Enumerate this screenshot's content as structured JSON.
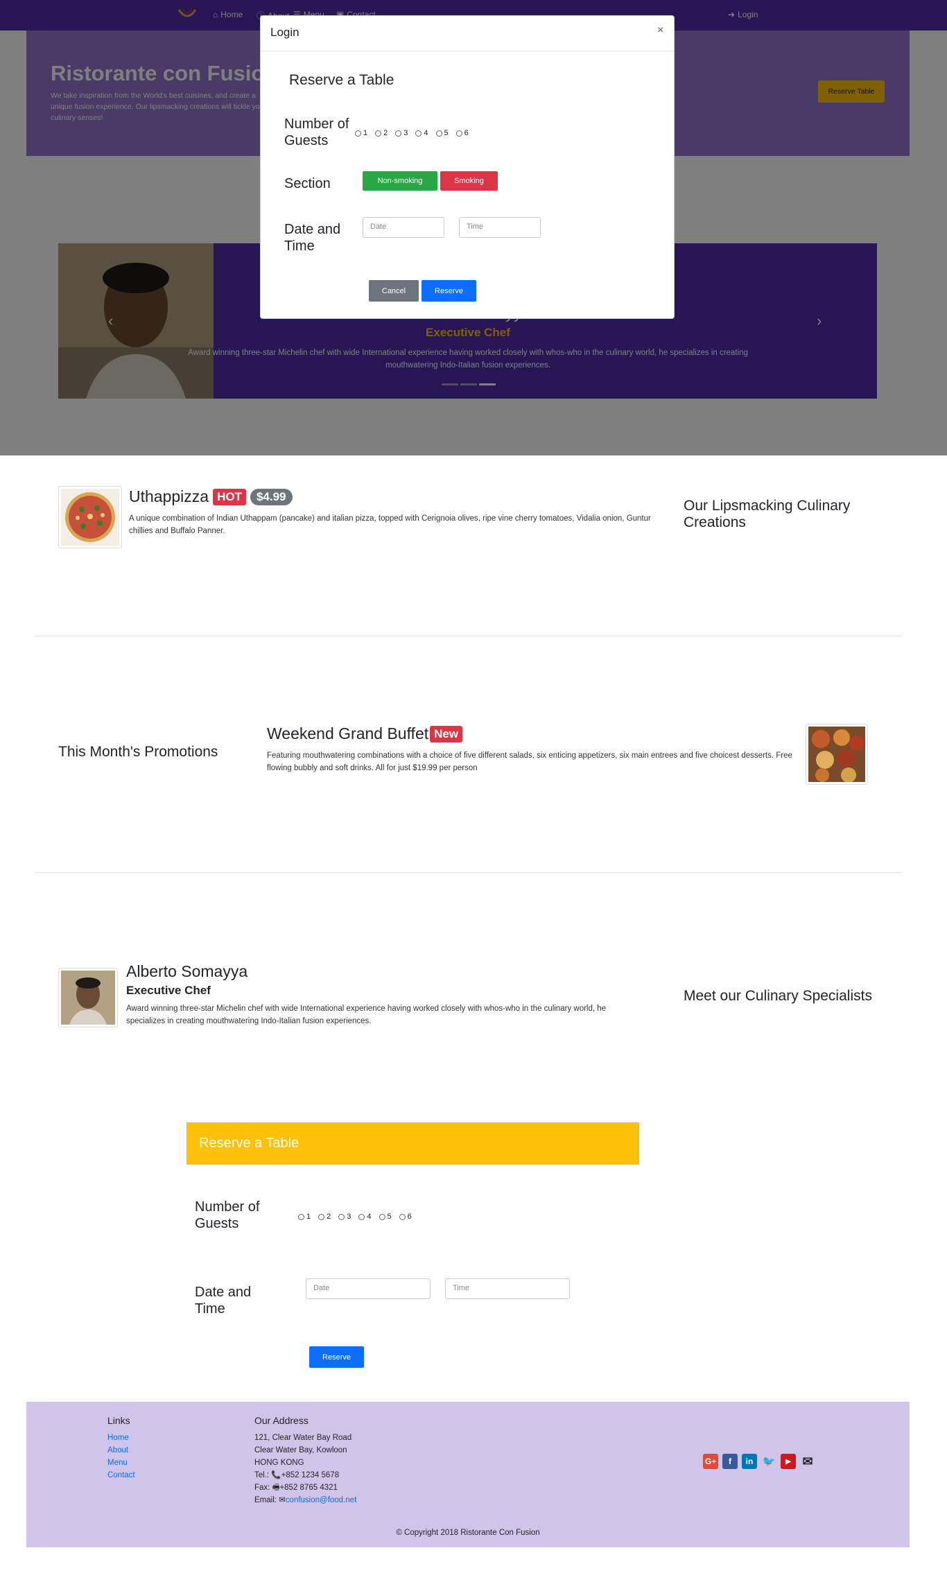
{
  "navbar": {
    "home": "Home",
    "about": "About",
    "menu": "Menu",
    "contact": "Contact",
    "login": "Login"
  },
  "jumbotron": {
    "title": "Ristorante con Fusion",
    "text": "We take inspiration from the World's best cuisines, and create a unique fusion experience. Our lipsmacking creations will tickle your culinary senses!",
    "button": "Reserve Table"
  },
  "carousel": {
    "name": "Alberto Somayya",
    "role": "Executive Chef",
    "description": "Award winning three-star Michelin chef with wide International experience having worked closely with whos-who in the culinary world, he specializes in creating mouthwatering Indo-Italian fusion experiences."
  },
  "modal": {
    "title": "Login",
    "close": "×",
    "heading": "Reserve a Table",
    "guests_label": "Number of Guests",
    "guest_options": [
      "1",
      "2",
      "3",
      "4",
      "5",
      "6"
    ],
    "section_label": "Section",
    "non_smoking": "Non-smoking",
    "smoking": "Smoking",
    "datetime_label": "Date and Time",
    "date_placeholder": "Date",
    "time_placeholder": "Time",
    "cancel": "Cancel",
    "reserve": "Reserve"
  },
  "dish": {
    "title": "Uthappizza",
    "badge": "HOT",
    "price": "$4.99",
    "description": "A unique combination of Indian Uthappam (pancake) and italian pizza, topped with Cerignoia olives, ripe vine cherry tomatoes, Vidalia onion, Guntur chillies and Buffalo Panner.",
    "section_heading": "Our Lipsmacking Culinary Creations"
  },
  "promotion": {
    "section_heading": "This Month's Promotions",
    "title": "Weekend Grand Buffet",
    "badge": "New",
    "description": "Featuring mouthwatering combinations with a choice of five different salads, six enticing appetizers, six main entrees and five choicest desserts. Free flowing bubbly and soft drinks. All for just $19.99 per person"
  },
  "leader": {
    "name": "Alberto Somayya",
    "role": "Executive Chef",
    "description": "Award winning three-star Michelin chef with wide International experience having worked closely with whos-who in the culinary world, he specializes in creating mouthwatering Indo-Italian fusion experiences.",
    "section_heading": "Meet our Culinary Specialists"
  },
  "reserve": {
    "heading": "Reserve a Table",
    "guests_label": "Number of Guests",
    "guest_options": [
      "1",
      "2",
      "3",
      "4",
      "5",
      "6"
    ],
    "datetime_label": "Date and Time",
    "date_placeholder": "Date",
    "time_placeholder": "Time",
    "submit": "Reserve"
  },
  "footer": {
    "links_heading": "Links",
    "links": [
      "Home",
      "About",
      "Menu",
      "Contact"
    ],
    "address_heading": "Our Address",
    "address": [
      "121, Clear Water Bay Road",
      "Clear Water Bay, Kowloon",
      "HONG KONG"
    ],
    "tel": "+852 1234 5678",
    "tel_label": "Tel.:",
    "fax": "+852 8765 4321",
    "fax_label": "Fax:",
    "email": "confusion@food.net",
    "email_label": "Email:",
    "copyright": "© Copyright 2018 Ristorante Con Fusion",
    "social_icons": [
      "google-plus-icon",
      "facebook-icon",
      "linkedin-icon",
      "twitter-icon",
      "youtube-icon",
      "envelope-icon"
    ]
  },
  "colors": {
    "primary_dark": "#512DA8",
    "primary_light": "#9575CD",
    "footer_bg": "#D1C4E9",
    "accent": "#FFC107",
    "success": "#28A745",
    "danger": "#DC3545",
    "primary_btn": "#0D6EFD"
  }
}
